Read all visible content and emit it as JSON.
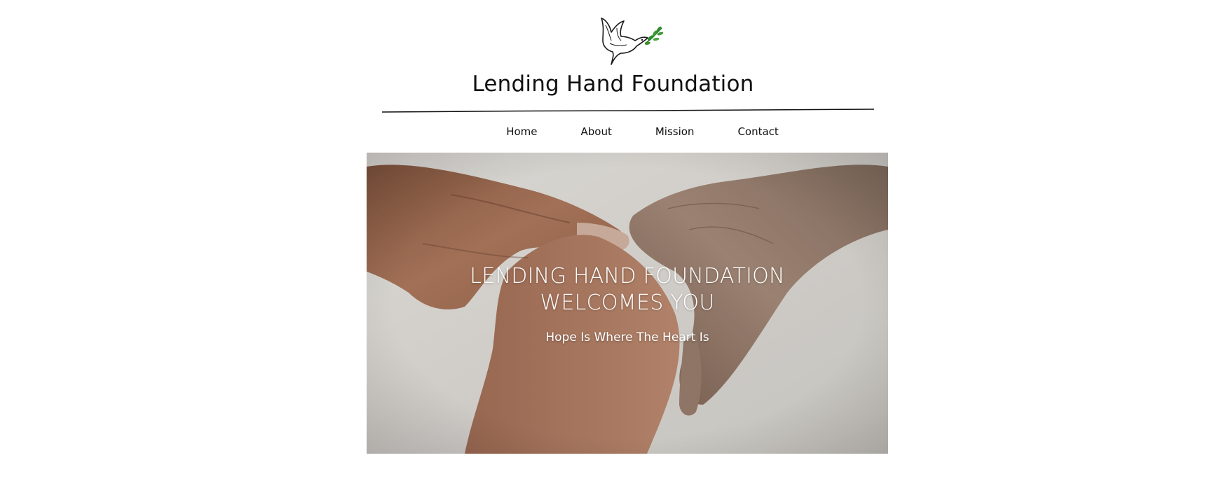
{
  "site": {
    "title": "Lending Hand Foundation",
    "logo_icon": "dove-with-olive-branch-icon"
  },
  "nav": {
    "items": [
      {
        "label": "Home"
      },
      {
        "label": "About"
      },
      {
        "label": "Mission"
      },
      {
        "label": "Contact"
      }
    ]
  },
  "hero": {
    "heading": "LENDING HAND FOUNDATION WELCOMES YOU",
    "subheading": "Hope Is Where The Heart Is",
    "image": "holding-hands-photo"
  },
  "colors": {
    "text": "#111111",
    "hero_text": "#ffffff",
    "leaf_green": "#2e8b2e"
  }
}
